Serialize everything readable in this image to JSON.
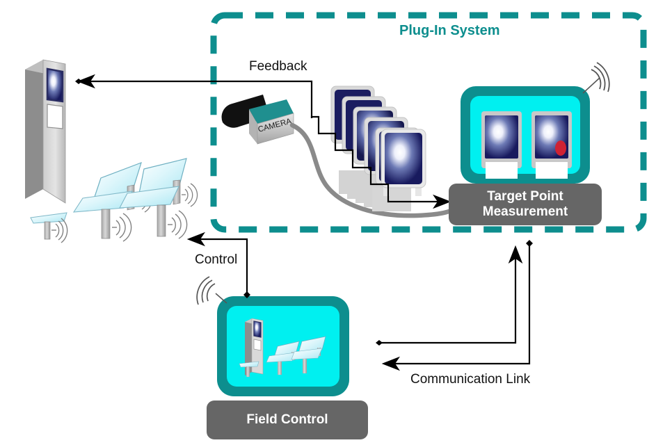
{
  "diagram": {
    "title": "Plug-In System",
    "background_color": "#ffffff",
    "accent_teal": "#0d8e8e",
    "screen_cyan": "#00f0f0",
    "label_gray": "#666666",
    "mirror_cyan": "#d6f5fa",
    "screen_navy": "#181a5e"
  },
  "labels": {
    "plug_in_system": "Plug-In System",
    "feedback": "Feedback",
    "control": "Control",
    "communication_link": "Communication Link",
    "camera": "CAMERA"
  },
  "boxes": {
    "target_point": {
      "line1": "Target Point",
      "line2": "Measurement"
    },
    "field_control": {
      "line1": "Field Control"
    }
  },
  "components": [
    {
      "name": "solar-tower",
      "type": "tower",
      "description": "Central receiver tower with glowing receiver panel"
    },
    {
      "name": "heliostat-field",
      "type": "heliostats",
      "count": 3,
      "description": "Heliostat mirrors on posts with wireless signal arcs"
    },
    {
      "name": "camera",
      "type": "camera",
      "label": "CAMERA"
    },
    {
      "name": "image-stack",
      "type": "screens",
      "count": 6,
      "description": "Stack of captured target images"
    },
    {
      "name": "target-point-measurement",
      "type": "tablet",
      "label": "Target Point Measurement"
    },
    {
      "name": "field-control",
      "type": "tablet",
      "label": "Field Control"
    }
  ],
  "connections": [
    {
      "name": "feedback",
      "label": "Feedback",
      "from": "image-stack",
      "to": "solar-tower",
      "style": "arrow"
    },
    {
      "name": "measurement-input",
      "label": "",
      "from": "camera",
      "to": "target-point-measurement",
      "style": "stair-arrow"
    },
    {
      "name": "camera-cable",
      "label": "",
      "from": "camera",
      "to": "target-point-measurement",
      "style": "gray-cable"
    },
    {
      "name": "control",
      "label": "Control",
      "from": "field-control",
      "to": "heliostat-field",
      "style": "arrow"
    },
    {
      "name": "communication-link-up",
      "label": "Communication Link",
      "from": "field-control",
      "to": "target-point-measurement",
      "style": "arrow"
    },
    {
      "name": "communication-link-down",
      "label": "Communication Link",
      "from": "target-point-measurement",
      "to": "field-control",
      "style": "arrow"
    }
  ]
}
